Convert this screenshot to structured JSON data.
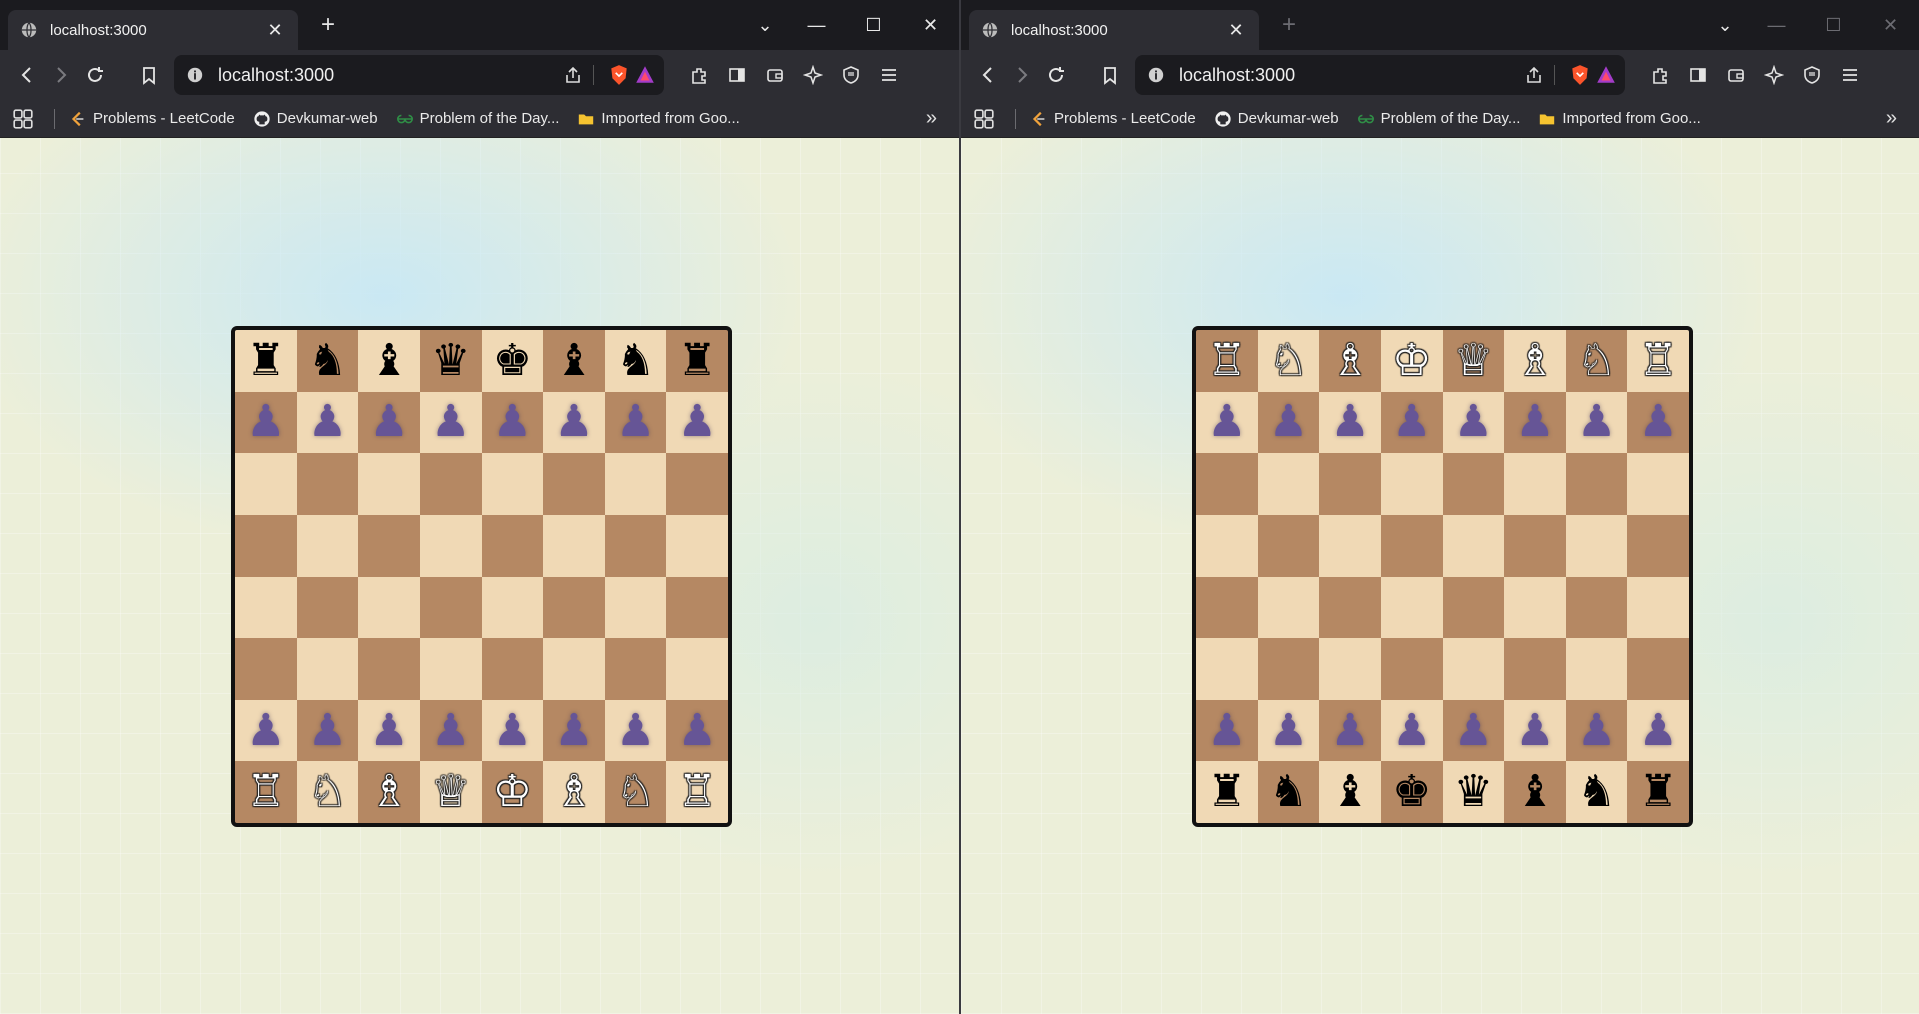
{
  "windows": [
    {
      "tab_title": "localhost:3000",
      "tab_close": "✕",
      "new_tab": "+",
      "url": "localhost:3000",
      "bookmarks": [
        "Problems - LeetCode",
        "Devkumar-web",
        "Problem of the Day...",
        "Imported from Goo..."
      ],
      "more_bookmarks": "»",
      "board": [
        [
          "♜",
          "♞",
          "♝",
          "♛",
          "♚",
          "♝",
          "♞",
          "♜"
        ],
        [
          "♟",
          "♟",
          "♟",
          "♟",
          "♟",
          "♟",
          "♟",
          "♟"
        ],
        [
          "",
          "",
          "",
          "",
          "",
          "",
          "",
          ""
        ],
        [
          "",
          "",
          "",
          "",
          "",
          "",
          "",
          ""
        ],
        [
          "",
          "",
          "",
          "",
          "",
          "",
          "",
          ""
        ],
        [
          "",
          "",
          "",
          "",
          "",
          "",
          "",
          ""
        ],
        [
          "♟",
          "♟",
          "♟",
          "♟",
          "♟",
          "♟",
          "♟",
          "♟"
        ],
        [
          "♖",
          "♘",
          "♗",
          "♕",
          "♔",
          "♗",
          "♘",
          "♖"
        ]
      ],
      "board_colors": [
        [
          "b",
          "b",
          "b",
          "b",
          "b",
          "b",
          "b",
          "b"
        ],
        [
          "p",
          "p",
          "p",
          "p",
          "p",
          "p",
          "p",
          "p"
        ],
        [
          "",
          "",
          "",
          "",
          "",
          "",
          "",
          ""
        ],
        [
          "",
          "",
          "",
          "",
          "",
          "",
          "",
          ""
        ],
        [
          "",
          "",
          "",
          "",
          "",
          "",
          "",
          ""
        ],
        [
          "",
          "",
          "",
          "",
          "",
          "",
          "",
          ""
        ],
        [
          "p",
          "p",
          "p",
          "p",
          "p",
          "p",
          "p",
          "p"
        ],
        [
          "w",
          "w",
          "w",
          "w",
          "w",
          "w",
          "w",
          "w"
        ]
      ],
      "first_square_light": true
    },
    {
      "tab_title": "localhost:3000",
      "tab_close": "✕",
      "new_tab": "+",
      "url": "localhost:3000",
      "bookmarks": [
        "Problems - LeetCode",
        "Devkumar-web",
        "Problem of the Day...",
        "Imported from Goo..."
      ],
      "more_bookmarks": "»",
      "board": [
        [
          "♖",
          "♘",
          "♗",
          "♔",
          "♕",
          "♗",
          "♘",
          "♖"
        ],
        [
          "♟",
          "♟",
          "♟",
          "♟",
          "♟",
          "♟",
          "♟",
          "♟"
        ],
        [
          "",
          "",
          "",
          "",
          "",
          "",
          "",
          ""
        ],
        [
          "",
          "",
          "",
          "",
          "",
          "",
          "",
          ""
        ],
        [
          "",
          "",
          "",
          "",
          "",
          "",
          "",
          ""
        ],
        [
          "",
          "",
          "",
          "",
          "",
          "",
          "",
          ""
        ],
        [
          "♟",
          "♟",
          "♟",
          "♟",
          "♟",
          "♟",
          "♟",
          "♟"
        ],
        [
          "♜",
          "♞",
          "♝",
          "♚",
          "♛",
          "♝",
          "♞",
          "♜"
        ]
      ],
      "board_colors": [
        [
          "w",
          "w",
          "w",
          "w",
          "w",
          "w",
          "w",
          "w"
        ],
        [
          "p",
          "p",
          "p",
          "p",
          "p",
          "p",
          "p",
          "p"
        ],
        [
          "",
          "",
          "",
          "",
          "",
          "",
          "",
          ""
        ],
        [
          "",
          "",
          "",
          "",
          "",
          "",
          "",
          ""
        ],
        [
          "",
          "",
          "",
          "",
          "",
          "",
          "",
          ""
        ],
        [
          "",
          "",
          "",
          "",
          "",
          "",
          "",
          ""
        ],
        [
          "p",
          "p",
          "p",
          "p",
          "p",
          "p",
          "p",
          "p"
        ],
        [
          "b",
          "b",
          "b",
          "b",
          "b",
          "b",
          "b",
          "b"
        ]
      ],
      "first_square_light": false
    }
  ],
  "colors": {
    "light_square": "#f0d9b5",
    "dark_square": "#b58863",
    "pawn": "#665596",
    "tab_bg": "#2d2d33",
    "chrome_bg": "#1b1b1f"
  }
}
